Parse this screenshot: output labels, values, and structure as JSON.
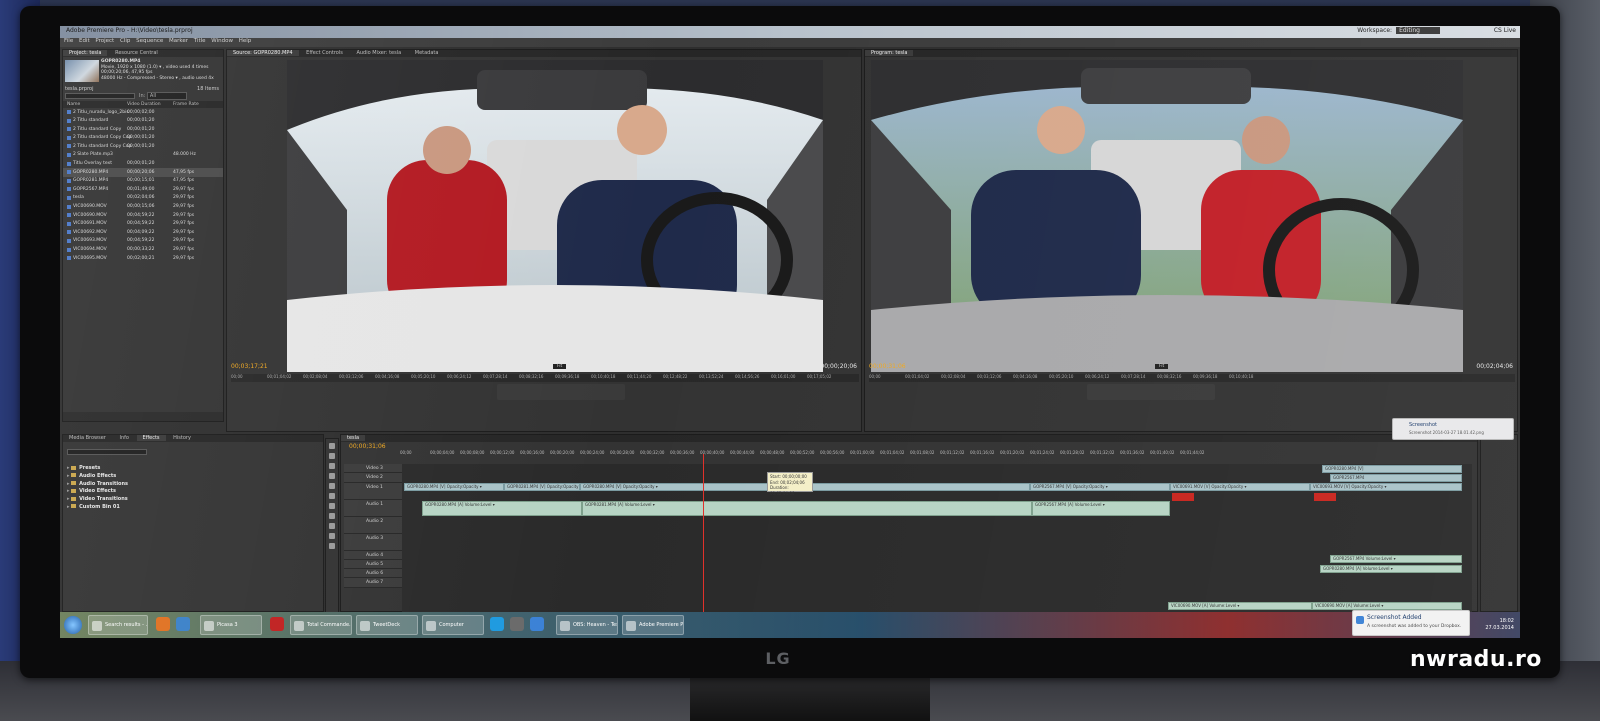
{
  "photo": {
    "watermark": "nwradu.ro",
    "monitor_brand": "LG"
  },
  "app": {
    "title": "Adobe Premiere Pro - H:\\Video\\tesla.prproj",
    "workspace_label": "Workspace:",
    "workspace_value": "Editing",
    "window_buttons": "CS Live",
    "menu": [
      "File",
      "Edit",
      "Project",
      "Clip",
      "Sequence",
      "Marker",
      "Title",
      "Window",
      "Help"
    ]
  },
  "project_panel": {
    "tabs": [
      "Project: tesla",
      "Resource Central"
    ],
    "clip_name": "GOPR0280.MP4",
    "clip_info": [
      "Movie, 1920 x 1080 (1.0)  ▾ , video used 4 times",
      "00;00;20;06, 47,95 fps",
      "48000 Hz - Compressed - Stereo  ▾ , audio used 4x"
    ],
    "project_file": "tesla.prproj",
    "item_count": "18 Items",
    "in_label": "In:",
    "in_value": "All",
    "columns": [
      "Name",
      "Video Duration",
      "Frame Rate"
    ],
    "items": [
      {
        "name": "2 Titlu_nuradu_logo_2bis",
        "duration": "00;00;02;00",
        "fps": ""
      },
      {
        "name": "2 Titlu standard",
        "duration": "00;00;01;20",
        "fps": ""
      },
      {
        "name": "2 Titlu standard Copy",
        "duration": "00;00;01;20",
        "fps": ""
      },
      {
        "name": "2 Titlu standard Copy Cop",
        "duration": "00;00;01;20",
        "fps": ""
      },
      {
        "name": "2 Titlu standard Copy Cop",
        "duration": "00;00;01;20",
        "fps": ""
      },
      {
        "name": "2 Slate Plate.mp3",
        "duration": "",
        "fps": "48.000 Hz"
      },
      {
        "name": "Titlu Overlay text",
        "duration": "00;00;01;20",
        "fps": ""
      },
      {
        "name": "GOPR0280.MP4",
        "duration": "00;00;20;06",
        "fps": "47,95 fps"
      },
      {
        "name": "GOPR0281.MP4",
        "duration": "00;00;15;01",
        "fps": "47,95 fps"
      },
      {
        "name": "GOPR2567.MP4",
        "duration": "00;01;49;00",
        "fps": "29,97 fps"
      },
      {
        "name": "tesla",
        "duration": "00;02;04;06",
        "fps": "29,97 fps"
      },
      {
        "name": "VIC00690.MOV",
        "duration": "00;00;15;06",
        "fps": "29,97 fps"
      },
      {
        "name": "VIC00690.MOV",
        "duration": "00;04;59;22",
        "fps": "29,97 fps"
      },
      {
        "name": "VIC00691.MOV",
        "duration": "00;04;59;22",
        "fps": "29,97 fps"
      },
      {
        "name": "VIC00692.MOV",
        "duration": "00;04;09;22",
        "fps": "29,97 fps"
      },
      {
        "name": "VIC00693.MOV",
        "duration": "00;04;59;22",
        "fps": "29,97 fps"
      },
      {
        "name": "VIC00694.MOV",
        "duration": "00;00;33;22",
        "fps": "29,97 fps"
      },
      {
        "name": "VIC00695.MOV",
        "duration": "00;02;00;21",
        "fps": "29,97 fps"
      }
    ],
    "selected_index": 7
  },
  "source_monitor": {
    "tabs": [
      "Source: GOPR0280.MP4",
      "Effect Controls",
      "Audio Mixer: tesla",
      "Metadata"
    ],
    "timecode_in": "00;03;17;21",
    "timecode_dur": "00;00;20;06",
    "fit": "Fit",
    "ruler": [
      "00;00",
      "00;01;04;02",
      "00;02;08;04",
      "00;03;12;06",
      "00;04;16;08",
      "00;05;20;10",
      "00;06;24;12",
      "00;07;28;14",
      "00;08;32;16",
      "00;09;36;18",
      "00;10;40;18",
      "00;11;44;20",
      "00;12;48;22",
      "00;13;52;24",
      "00;14;56;26",
      "00;16;01;00",
      "00;17;05;02"
    ]
  },
  "program_monitor": {
    "tabs": [
      "Program: tesla"
    ],
    "timecode_in": "00;00;31;06",
    "timecode_dur": "00;02;04;06",
    "fit": "Fit",
    "ruler": [
      "00;00",
      "00;01;04;02",
      "00;02;08;04",
      "00;03;12;06",
      "00;04;16;08",
      "00;05;20;10",
      "00;06;24;12",
      "00;07;28;14",
      "00;08;32;16",
      "00;09;36;18",
      "00;10;40;18"
    ]
  },
  "effects_panel": {
    "tabs": [
      "Media Browser",
      "Info",
      "Effects",
      "History"
    ],
    "items": [
      "Presets",
      "Audio Effects",
      "Audio Transitions",
      "Video Effects",
      "Video Transitions",
      "Custom Bin 01"
    ]
  },
  "timeline": {
    "tab": "tesla",
    "timecode": "00;00;31;06",
    "ruler": [
      "00;00",
      "00;00;04;00",
      "00;00;08;00",
      "00;00;12;00",
      "00;00;16;00",
      "00;00;20;00",
      "00;00;24;00",
      "00;00;28;00",
      "00;00;32;00",
      "00;00;36;00",
      "00;00;40;00",
      "00;00;44;00",
      "00;00;48;00",
      "00;00;52;00",
      "00;00;56;00",
      "00;01;00;00",
      "00;01;04;02",
      "00;01;08;02",
      "00;01;12;02",
      "00;01;16;02",
      "00;01;20;02",
      "00;01;24;02",
      "00;01;28;02",
      "00;01;32;02",
      "00;01;36;02",
      "00;01;40;02",
      "00;01;44;02"
    ],
    "tracks": [
      "Video 3",
      "Video 2",
      "Video 1",
      "Audio 1",
      "Audio 2",
      "Audio 3",
      "Audio 4",
      "Audio 5",
      "Audio 6",
      "Audio 7"
    ],
    "clips": {
      "v1_a": "GOPR0280.MP4 [V]  Opacity:Opacity ▾",
      "v1_b": "GOPR0281.MP4 [V]  Opacity:Opacity ▾",
      "v1_c": "GOPR0280.MP4 [V]  Opacity:Opacity ▾",
      "v1_d": "GOPR2567.MP4 [V]  Opacity:Opacity ▾",
      "v1_e": "VIC00691.MOV [V]  Opacity:Opacity ▾",
      "v1_f": "VIC00693.MOV [V]  Opacity:Opacity ▾",
      "v3_a": "GOPR0280.MP4 [V]",
      "v2_a": "GOPR2567.MP4",
      "a1_a": "GOPR0280.MP4 [A]  Volume:Level ▾",
      "a1_b": "GOPR0281.MP4 [A]  Volume:Level ▾",
      "a1_c": "GOPR0280.MP4 [A]  Volume:Level ▾",
      "a1_d": "GOPR2567.MP4 [A]  Volume:Level ▾",
      "a3_a": "GOPR2567.MP4  Volume:Level ▾",
      "a3_b": "GOPR0280.MP4 [A]  Volume:Level ▾",
      "a7_a": "VIC00690.MOV [A]  Volume:Level ▾",
      "a7_b": "VIC00690.MOV [A]  Volume:Level ▾"
    },
    "tooltip": [
      "Start: 00;00;00;00",
      "End: 00;02;04;06",
      "Duration: 00;02;04;06"
    ]
  },
  "taskbar": {
    "buttons": [
      "Search results - ...",
      "Picasa 3",
      "Total Commande...",
      "TweetDeck",
      "Computer",
      "OBS: Heaven - Tesla...",
      "Adobe Premiere P..."
    ],
    "clock_time": "18:02",
    "clock_date": "27.03.2014"
  },
  "notifications": {
    "screenshot": {
      "title": "Screenshot Added",
      "body": "A screenshot was added to your Dropbox."
    },
    "screenshot_small": {
      "title": "Screenshot",
      "body": "Screenshot 2014-03-27 18.01.42.png"
    }
  }
}
